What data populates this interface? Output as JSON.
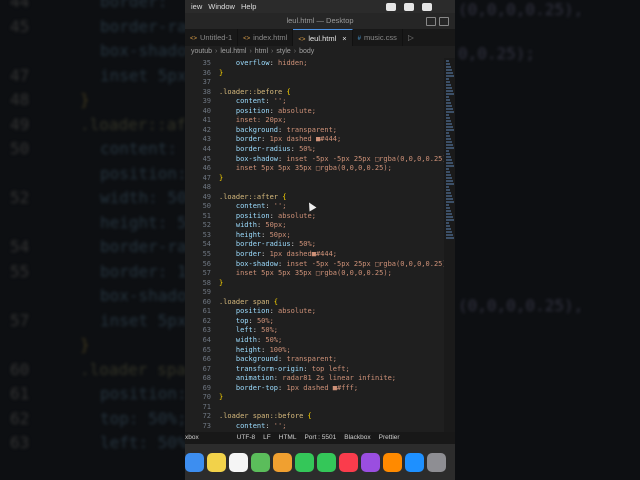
{
  "menubar": {
    "items": [
      "iew",
      "Window",
      "Help"
    ]
  },
  "window_title": "leul.html — Desktop",
  "tabs": [
    {
      "label": "Untitled-1",
      "active": false,
      "icon": "file-icon"
    },
    {
      "label": "index.html",
      "active": false,
      "icon": "html-icon"
    },
    {
      "label": "leul.html",
      "active": true,
      "icon": "html-icon",
      "close": "×"
    },
    {
      "label": "music.css",
      "active": false,
      "icon": "css-icon"
    }
  ],
  "breadcrumb": [
    "youtub",
    "leul.html",
    "html",
    "style",
    "body"
  ],
  "code_lines": [
    {
      "n": "35",
      "t": "    overflow: hidden;"
    },
    {
      "n": "36",
      "t": "}"
    },
    {
      "n": "37",
      "t": ""
    },
    {
      "n": "38",
      "t": ".loader::before {"
    },
    {
      "n": "39",
      "t": "    content: '';"
    },
    {
      "n": "40",
      "t": "    position: absolute;"
    },
    {
      "n": "41",
      "t": "    inset: 20px;"
    },
    {
      "n": "42",
      "t": "    background: transparent;"
    },
    {
      "n": "43",
      "t": "    border: 1px dashed ■#444;"
    },
    {
      "n": "44",
      "t": "    border-radius: 50%;"
    },
    {
      "n": "45",
      "t": "    box-shadow: inset -5px -5px 25px □rgba(0,0,0,0.25),"
    },
    {
      "n": "46",
      "t": "    inset 5px 5px 35px □rgba(0,0,0,0.25);"
    },
    {
      "n": "47",
      "t": "}"
    },
    {
      "n": "48",
      "t": ""
    },
    {
      "n": "49",
      "t": ".loader::after {"
    },
    {
      "n": "50",
      "t": "    content: '';"
    },
    {
      "n": "51",
      "t": "    position: absolute;"
    },
    {
      "n": "52",
      "t": "    width: 50px;"
    },
    {
      "n": "53",
      "t": "    height: 50px;"
    },
    {
      "n": "54",
      "t": "    border-radius: 50%;"
    },
    {
      "n": "55",
      "t": "    border: 1px dashed■#444;"
    },
    {
      "n": "56",
      "t": "    box-shadow: inset -5px -5px 25px □rgba(0,0,0,0.25),"
    },
    {
      "n": "57",
      "t": "    inset 5px 5px 35px □rgba(0,0,0,0.25);"
    },
    {
      "n": "58",
      "t": "}"
    },
    {
      "n": "59",
      "t": ""
    },
    {
      "n": "60",
      "t": ".loader span {"
    },
    {
      "n": "61",
      "t": "    position: absolute;"
    },
    {
      "n": "62",
      "t": "    top: 50%;"
    },
    {
      "n": "63",
      "t": "    left: 50%;"
    },
    {
      "n": "64",
      "t": "    width: 50%;"
    },
    {
      "n": "65",
      "t": "    height: 100%;"
    },
    {
      "n": "66",
      "t": "    background: transparent;"
    },
    {
      "n": "67",
      "t": "    transform-origin: top left;"
    },
    {
      "n": "68",
      "t": "    animation: radar81 2s linear infinite;"
    },
    {
      "n": "69",
      "t": "    border-top: 1px dashed ■#fff;"
    },
    {
      "n": "70",
      "t": "}"
    },
    {
      "n": "71",
      "t": ""
    },
    {
      "n": "72",
      "t": ".loader span::before {"
    },
    {
      "n": "73",
      "t": "    content: '';"
    }
  ],
  "statusbar": [
    "xbox",
    "UTF-8",
    "LF",
    "HTML",
    "Port : 5501",
    "Blackbox",
    "Prettier"
  ],
  "background": {
    "numbers": [
      "44",
      "45",
      "",
      "47",
      "48",
      "49",
      "50",
      "",
      "52",
      "",
      "54",
      "55",
      "",
      "57",
      "",
      "60",
      "61",
      "62",
      "63"
    ],
    "lines": [
      "border:",
      "border-ra",
      "box-shadow",
      "inset 5px",
      "}",
      ".loader::aft",
      "content:",
      "position:",
      "width: 50",
      "height: 5",
      "border-ra",
      "border: 1",
      "box-shadow",
      "inset 5px",
      "}",
      ".loader spa",
      "position:",
      "top: 50%;",
      "left: 50%"
    ],
    "right_fragments": [
      "0,0.25);",
      "(0,0,0,0.25),",
      "(0,0,0,0.25),"
    ]
  },
  "dock": [
    {
      "icon": "finder-icon",
      "color": "#3d8ef0"
    },
    {
      "icon": "notes-icon",
      "color": "#f2d24a"
    },
    {
      "icon": "reminders-icon",
      "color": "#f5f5f5"
    },
    {
      "icon": "maps-icon",
      "color": "#5bbd5b"
    },
    {
      "icon": "photos-icon",
      "color": "#f0a030"
    },
    {
      "icon": "messages-icon",
      "color": "#34c759"
    },
    {
      "icon": "facetime-icon",
      "color": "#34c759"
    },
    {
      "icon": "music-icon",
      "color": "#fa3c4c"
    },
    {
      "icon": "podcasts-icon",
      "color": "#9a4ee0"
    },
    {
      "icon": "books-icon",
      "color": "#ff8a00"
    },
    {
      "icon": "appstore-icon",
      "color": "#1e90ff"
    },
    {
      "icon": "settings-icon",
      "color": "#8e8e93"
    }
  ]
}
